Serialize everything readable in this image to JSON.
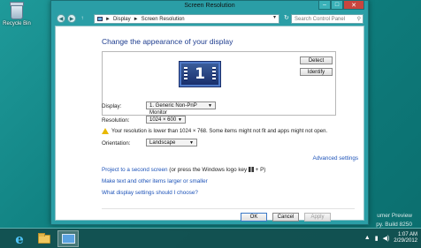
{
  "desktop": {
    "recycle_bin_label": "Recycle Bin",
    "watermark_line1": "umer Preview",
    "watermark_line2": "py. Build 8250"
  },
  "taskbar": {
    "clock_time": "1:07 AM",
    "clock_date": "2/29/2012"
  },
  "window": {
    "title": "Screen Resolution",
    "breadcrumb": [
      "Display",
      "Screen Resolution"
    ],
    "breadcrumb_sep": "►",
    "search_placeholder": "Search Control Panel",
    "heading": "Change the appearance of your display",
    "detect_label": "Detect",
    "identify_label": "Identify",
    "monitor_number": "1",
    "display_label": "Display:",
    "display_value": "1. Generic Non-PnP Monitor",
    "resolution_label": "Resolution:",
    "resolution_value": "1024 × 600",
    "warning_text": "Your resolution is lower than 1024 × 768. Some items might not fit and apps might not open.",
    "orientation_label": "Orientation:",
    "orientation_value": "Landscape",
    "advanced_link": "Advanced settings",
    "link_project_before": "Project to a second screen",
    "link_project_after": " (or press the Windows logo key",
    "link_project_tail": "+ P)",
    "link_text_size": "Make text and other items larger or smaller",
    "link_display_settings": "What display settings should I choose?",
    "ok_label": "OK",
    "cancel_label": "Cancel",
    "apply_label": "Apply"
  },
  "colors": {
    "accent": "#2a9ea6",
    "link": "#1c52b8",
    "heading": "#1e3d8f",
    "desktop": "#1a8c8c"
  }
}
